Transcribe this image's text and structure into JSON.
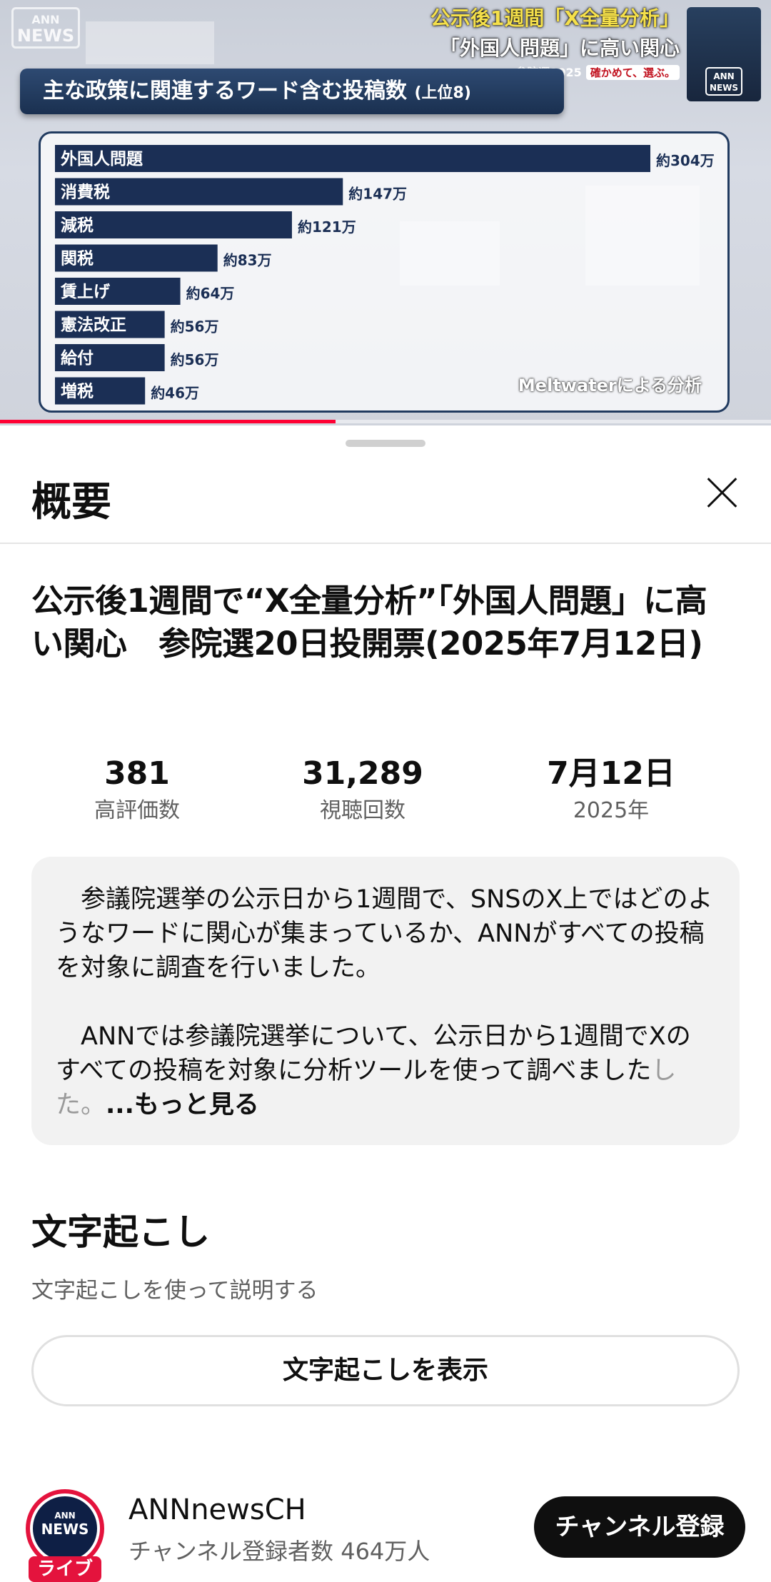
{
  "video": {
    "logo_line1": "ANN",
    "logo_line2": "NEWS",
    "headline_line1": "公示後1週間「X全量分析」",
    "headline_line2": "「外国人問題」に高い関心",
    "headline_line3": "参院選2025",
    "headline_chip": "確かめて、選ぶ。",
    "badge_line1": "ANN",
    "badge_line2": "NEWS",
    "chart_title": "主な政策に関連するワード含む投稿数",
    "chart_title_suffix": "(上位8)",
    "source_note": "Meltwaterによる分析",
    "progress": 0.435
  },
  "chart_data": {
    "type": "bar",
    "orientation": "horizontal",
    "title": "主な政策に関連するワード含む投稿数(上位8)",
    "categories": [
      "外国人問題",
      "消費税",
      "減税",
      "関税",
      "賃上げ",
      "憲法改正",
      "給付",
      "増税"
    ],
    "values": [
      304,
      147,
      121,
      83,
      64,
      56,
      56,
      46
    ],
    "value_labels": [
      "約304万",
      "約147万",
      "約121万",
      "約83万",
      "約64万",
      "約56万",
      "約56万",
      "約46万"
    ],
    "unit": "万",
    "bar_color": "#1b2f55",
    "annotation": "Meltwaterによる分析"
  },
  "sheet": {
    "title": "概要",
    "close_icon": "close-icon",
    "video_title": "公示後1週間で“X全量分析”「外国人問題」に高い関心　参院選20日投開票(2025年7月12日)",
    "stats": [
      {
        "value": "381",
        "label": "高評価数"
      },
      {
        "value": "31,289",
        "label": "視聴回数"
      },
      {
        "value": "7月12日",
        "label": "2025年"
      }
    ],
    "description_p1": "参議院選挙の公示日から1週間で、SNSのX上ではどのようなワードに関心が集まっているか、ANNがすべての投稿を対象に調査を行いました。",
    "description_p2": "ANNでは参議院選挙について、公示日から1週間でXのすべての投稿を対象に分析ツールを使って調べました",
    "description_p2_fade": "した。",
    "more_label": "...もっと見る",
    "transcript_title": "文字起こし",
    "transcript_sub": "文字起こしを使って説明する",
    "transcript_button": "文字起こしを表示"
  },
  "channel": {
    "avatar_line1": "ANN",
    "avatar_line2": "NEWS",
    "live_label": "ライブ",
    "name": "ANNnewsCH",
    "subscribers": "チャンネル登録者数 464万人",
    "subscribe_label": "チャンネル登録"
  },
  "colors": {
    "accent_red": "#ff0033",
    "navy": "#1b2f55",
    "subscribe_bg": "#0f0f0f"
  }
}
